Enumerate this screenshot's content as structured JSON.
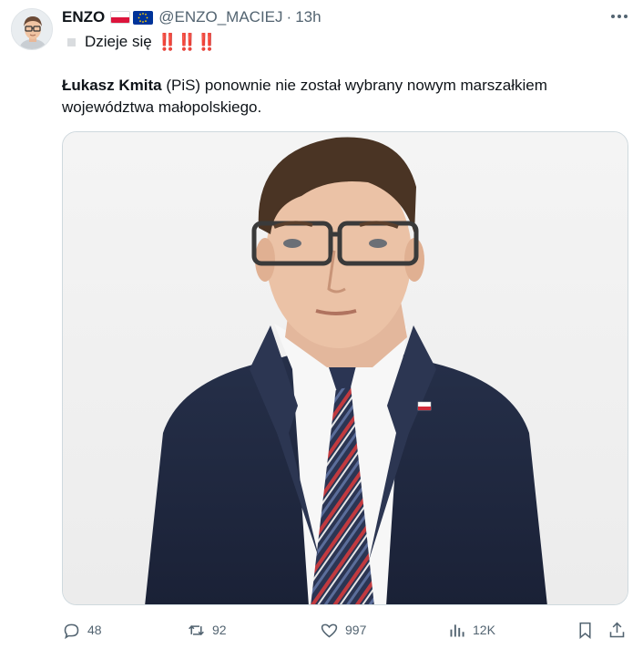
{
  "tweet": {
    "author": {
      "display_name": "ENZO",
      "handle": "@ENZO_MACIEJ",
      "separator": "·",
      "time": "13h"
    },
    "status_line": {
      "text": "Dzieje się",
      "emphasis": "‼️‼️‼️"
    },
    "body": {
      "bold": "Łukasz Kmita",
      "rest": " (PiS) ponownie nie został wybrany nowym marszałkiem województwa małopolskiego."
    },
    "stats": {
      "replies": "48",
      "reposts": "92",
      "likes": "997",
      "views": "12K"
    }
  },
  "icons": {
    "more": "more-icon",
    "reply": "reply-icon",
    "repost": "repost-icon",
    "like": "heart-icon",
    "views": "views-icon",
    "bookmark": "bookmark-icon",
    "share": "share-icon"
  },
  "colors": {
    "text": "#0f1419",
    "secondary": "#536471",
    "border": "#cfd9de",
    "emphasis": "#c8102e"
  }
}
